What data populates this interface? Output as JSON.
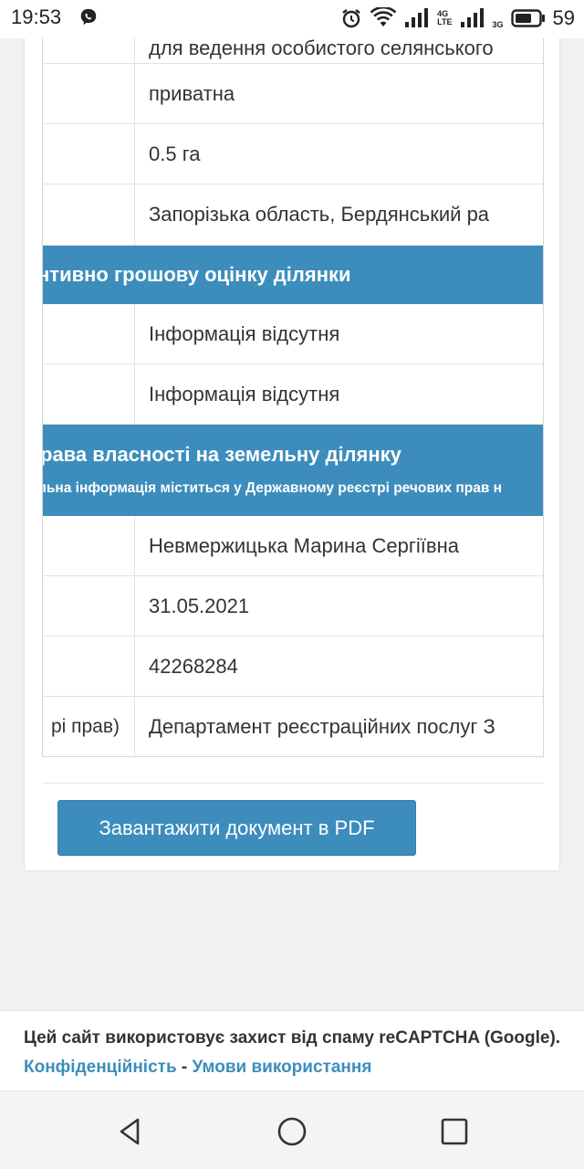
{
  "status_bar": {
    "time": "19:53",
    "network_1": "4G",
    "network_1_sub": "LTE",
    "network_2": "3G",
    "battery_percent": "59"
  },
  "table": {
    "rows_top": [
      {
        "label": "",
        "value": "для ведення особистого селянського"
      },
      {
        "label": "",
        "value": "приватна"
      },
      {
        "label": "",
        "value": "0.5 га"
      },
      {
        "label": "",
        "value": "Запорізька область, Бердянський ра"
      }
    ],
    "section_valuation": {
      "title": "нтивно грошову оцінку ділянки"
    },
    "rows_valuation": [
      {
        "label": "",
        "value": "Інформація відсутня"
      },
      {
        "label": "",
        "value": "Інформація відсутня"
      }
    ],
    "section_ownership": {
      "title": "рава власності на земельну ділянку",
      "subtitle": "льна інформація міститься у Державному реєстрі речових прав н"
    },
    "rows_ownership": [
      {
        "label": "",
        "value": "Невмержицька Марина Сергіївна"
      },
      {
        "label": "",
        "value": "31.05.2021"
      },
      {
        "label": "",
        "value": "42268284"
      },
      {
        "label": "рі прав)",
        "value": "Департамент реєстраційних послуг З"
      }
    ]
  },
  "actions": {
    "download_pdf_label": "Завантажити документ в PDF"
  },
  "recaptcha_footer": {
    "text": "Цей сайт використовує захист від спаму reCAPTCHA (Google). ",
    "privacy_link": "Конфіденційність",
    "separator": " - ",
    "terms_link": "Умови використання"
  },
  "navigation_bar": {
    "buttons": [
      "back-icon",
      "home-icon",
      "recents-icon"
    ]
  },
  "colors": {
    "accent": "#3c8dbc",
    "page_background": "#f1f1f1"
  }
}
